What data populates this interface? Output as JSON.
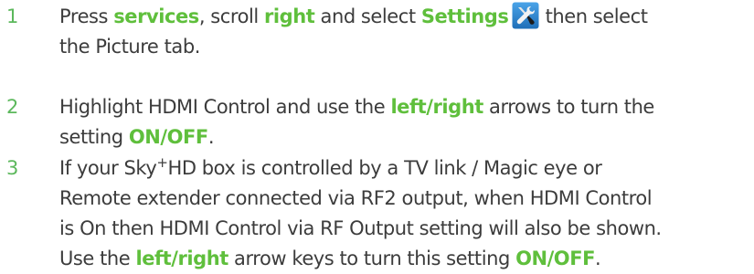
{
  "steps": [
    {
      "number": "1",
      "line1_prefix": "Press ",
      "kw_services": "services",
      "line1_mid1": ", scroll ",
      "kw_right": "right",
      "line1_mid2": " and select ",
      "kw_settings": "Settings",
      "line1_suffix": " then select",
      "line2": "the Picture tab.",
      "icon": "wrench-screwdriver-icon"
    },
    {
      "number": "2",
      "line1_prefix": "Highlight HDMI Control and use the ",
      "kw_leftright": "left/right",
      "line1_suffix": " arrows to turn the",
      "line2_prefix": "setting ",
      "kw_onoff": "ON/OFF",
      "line2_suffix": "."
    },
    {
      "number": "3",
      "line1_prefix": "If your Sky",
      "superscript": "+",
      "line1_suffix": "HD box is controlled by a TV link / Magic eye or",
      "line2": "Remote extender connected via RF2 output, when HDMI Control",
      "line3": "is On then HDMI Control via RF Output setting will also be shown.",
      "line4_prefix": "Use the ",
      "kw_leftright": "left/right",
      "line4_mid": " arrow keys to turn this setting ",
      "kw_onoff": "ON/OFF",
      "line4_suffix": "."
    }
  ],
  "colors": {
    "keyword": "#5fbf3c",
    "number": "#5cb85c",
    "text": "#3c3c3c",
    "icon_bg": "#2a7fc7"
  }
}
